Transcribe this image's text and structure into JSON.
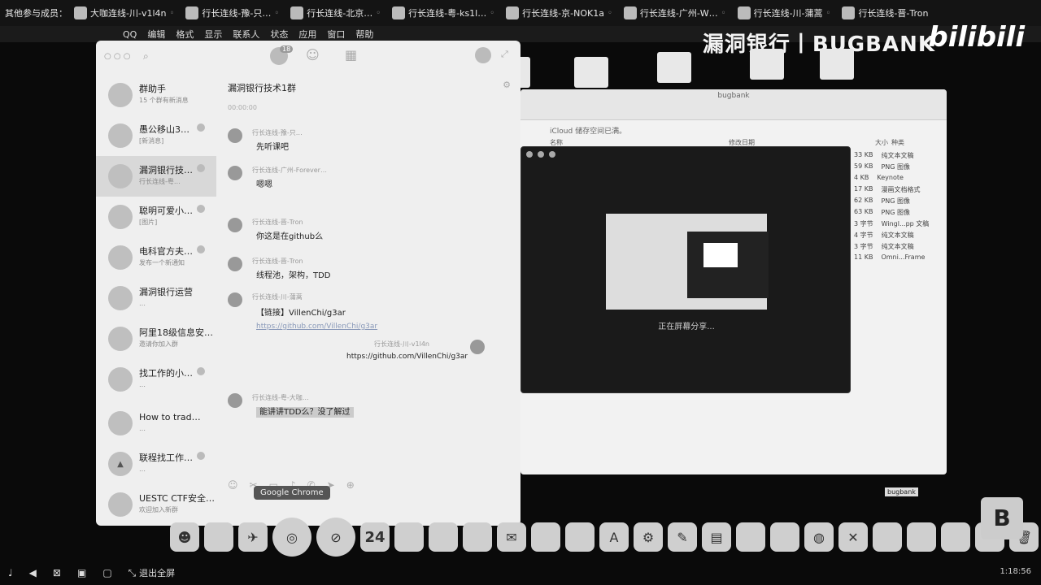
{
  "participants": {
    "label": "其他参与成员：",
    "people": [
      "大咖连线-川-v1l4n",
      "行长连线-豫-只…",
      "行长连线-北京…",
      "行长连线-粤-ks1l…",
      "行长连线-京-NOK1a",
      "行长连线-广州-W…",
      "行长连线-川-蒲蒿",
      "行长连线-晋-Tron"
    ]
  },
  "menubar": {
    "items": [
      "QQ",
      "编辑",
      "格式",
      "显示",
      "联系人",
      "状态",
      "应用",
      "窗口",
      "帮助"
    ]
  },
  "brand": {
    "text": "漏洞银行丨BUGBANK",
    "bili": "bilibili"
  },
  "qq": {
    "unread_count": "18",
    "chats": [
      {
        "name": "群助手",
        "preview": "15 个群有新消息"
      },
      {
        "name": "愚公移山3…",
        "preview": "[新消息]"
      },
      {
        "name": "漏洞银行技…",
        "preview": "行长连线-粤…"
      },
      {
        "name": "聪明可爱小…",
        "preview": "[图片]"
      },
      {
        "name": "电科官方夫…",
        "preview": "发布一个新通知"
      },
      {
        "name": "漏洞银行运营",
        "preview": "…"
      },
      {
        "name": "阿里18级信息安…",
        "preview": "邀请你加入群"
      },
      {
        "name": "找工作的小…",
        "preview": "…"
      },
      {
        "name": "How to trad…",
        "preview": "…"
      },
      {
        "name": "联程找工作…",
        "preview": "…"
      },
      {
        "name": "UESTC CTF安全…",
        "preview": "欢迎加入新群"
      }
    ],
    "conversation": {
      "title": "漏洞银行技术1群",
      "time": "00:00:00",
      "messages": [
        {
          "sender": "行长连线-豫-只…",
          "body": "先听课吧"
        },
        {
          "sender": "行长连线-广州-Forever…",
          "body": "嗯嗯"
        },
        {
          "sender": "行长连线-晋-Tron",
          "body": "你这是在github么"
        },
        {
          "sender": "行长连线-晋-Tron",
          "body": "线程池，架构，TDD"
        },
        {
          "sender": "行长连线-川-蒲蒿",
          "body": "【链接】VillenChi/g3ar",
          "link": "https://github.com/VillenChi/g3ar"
        },
        {
          "sender": "行长连线-川-v1l4n",
          "body": "",
          "link": "https://github.com/VillenChi/g3ar"
        },
        {
          "sender": "行长连线-粤-大咖…",
          "body": "能讲讲TDD么？没了解过"
        }
      ]
    }
  },
  "finder": {
    "title": "bugbank",
    "notice": "iCloud 储存空间已满。",
    "columns": [
      "名称",
      "修改日期",
      "大小",
      "种类"
    ],
    "rows": [
      {
        "size": "33 KB",
        "kind": "纯文本文稿"
      },
      {
        "size": "59 KB",
        "kind": "PNG 图像"
      },
      {
        "size": "4 KB",
        "kind": "Keynote"
      },
      {
        "size": "17 KB",
        "kind": "漫画文档格式"
      },
      {
        "size": "62 KB",
        "kind": "PNG 图像"
      },
      {
        "size": "63 KB",
        "kind": "PNG 图像"
      },
      {
        "size": "3 字节",
        "kind": "Wingl...pp 文稿"
      },
      {
        "size": "4 字节",
        "kind": "纯文本文稿"
      },
      {
        "size": "3 字节",
        "kind": "纯文本文稿"
      },
      {
        "size": "11 KB",
        "kind": "Omni...Frame"
      }
    ]
  },
  "share": {
    "label": "正在屏幕分享..."
  },
  "dock": {
    "tooltip": "Google Chrome",
    "calendar_day": "24"
  },
  "bottombar": {
    "exit_fullscreen": "退出全屏",
    "time": "1:18:56"
  },
  "bugbank_mini": "bugbank"
}
